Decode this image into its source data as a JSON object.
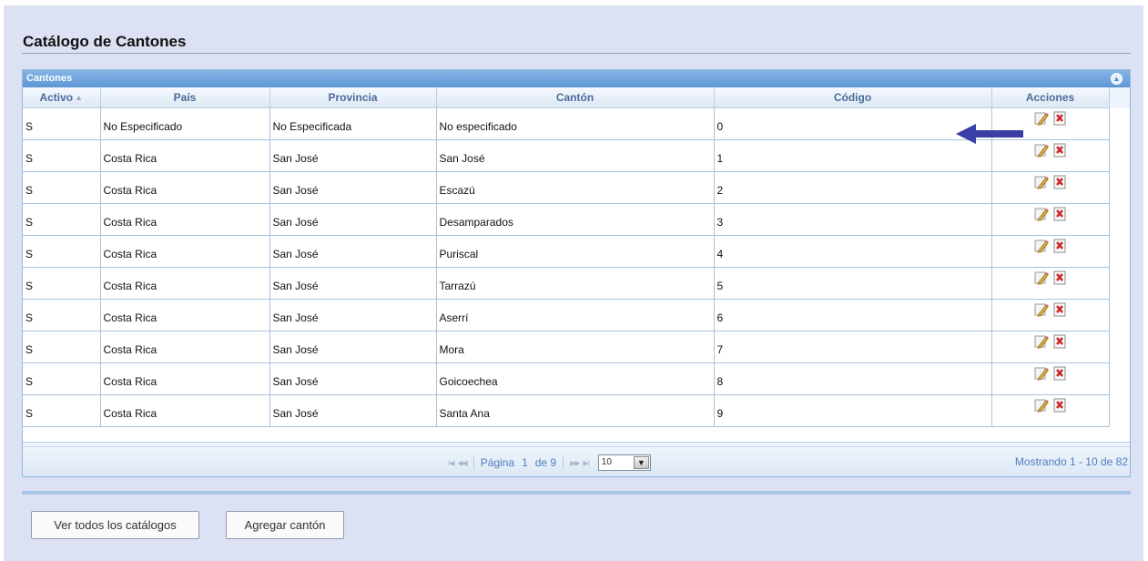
{
  "page": {
    "title": "Catálogo de Cantones"
  },
  "grid": {
    "caption": "Cantones",
    "columns": [
      "Activo",
      "País",
      "Provincia",
      "Cantón",
      "Código",
      "Acciones"
    ],
    "rows": [
      [
        "S",
        "No Especificado",
        "No Especificada",
        "No especificado",
        "0"
      ],
      [
        "S",
        "Costa Rica",
        "San José",
        "San José",
        "1"
      ],
      [
        "S",
        "Costa Rica",
        "San José",
        "Escazú",
        "2"
      ],
      [
        "S",
        "Costa Rica",
        "San José",
        "Desamparados",
        "3"
      ],
      [
        "S",
        "Costa Rica",
        "San José",
        "Puriscal",
        "4"
      ],
      [
        "S",
        "Costa Rica",
        "San José",
        "Tarrazú",
        "5"
      ],
      [
        "S",
        "Costa Rica",
        "San José",
        "Aserrí",
        "6"
      ],
      [
        "S",
        "Costa Rica",
        "San José",
        "Mora",
        "7"
      ],
      [
        "S",
        "Costa Rica",
        "San José",
        "Goicoechea",
        "8"
      ],
      [
        "S",
        "Costa Rica",
        "San José",
        "Santa Ana",
        "9"
      ]
    ],
    "row_actions": [
      "edit-icon",
      "delete-icon"
    ]
  },
  "pager": {
    "page_label": "Página",
    "current_page": "1",
    "of_label": "de 9",
    "page_size": "10",
    "summary": "Mostrando 1 - 10 de 82"
  },
  "buttons": {
    "view_all": "Ver todos los catálogos",
    "add": "Agregar cantón"
  },
  "colors": {
    "accent": "#5e97d6",
    "annotation_arrow": "#3a3fa8",
    "background": "#dde1f4"
  }
}
